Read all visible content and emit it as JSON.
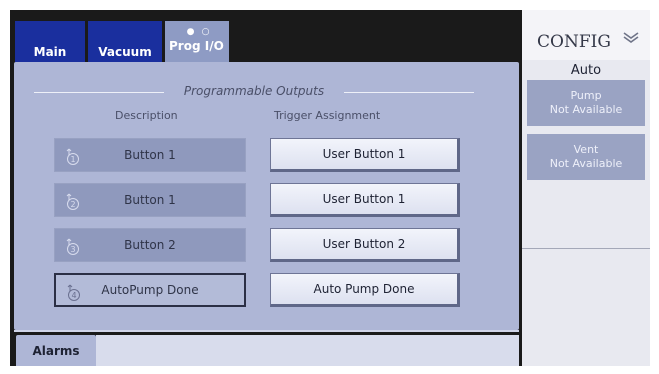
{
  "tabs": [
    {
      "label": "Main"
    },
    {
      "label": "Vacuum"
    },
    {
      "label": "Prog I/O",
      "page_dots": "● ○"
    }
  ],
  "section": {
    "title": "Programmable Outputs",
    "col_description": "Description",
    "col_trigger": "Trigger Assignment"
  },
  "outputs": [
    {
      "number": "1",
      "description": "Button 1",
      "trigger": "User Button 1"
    },
    {
      "number": "2",
      "description": "Button 1",
      "trigger": "User Button 1"
    },
    {
      "number": "3",
      "description": "Button 2",
      "trigger": "User Button 2"
    },
    {
      "number": "4",
      "description": "AutoPump Done",
      "trigger": "Auto Pump Done"
    }
  ],
  "bottom": {
    "alarms_label": "Alarms"
  },
  "config": {
    "title": "CONFIG",
    "mode": "Auto",
    "pump": {
      "name": "Pump",
      "status": "Not Available"
    },
    "vent": {
      "name": "Vent",
      "status": "Not Available"
    }
  },
  "colors": {
    "tab_blue": "#1a2f9e",
    "panel": "#aeb6d6"
  }
}
